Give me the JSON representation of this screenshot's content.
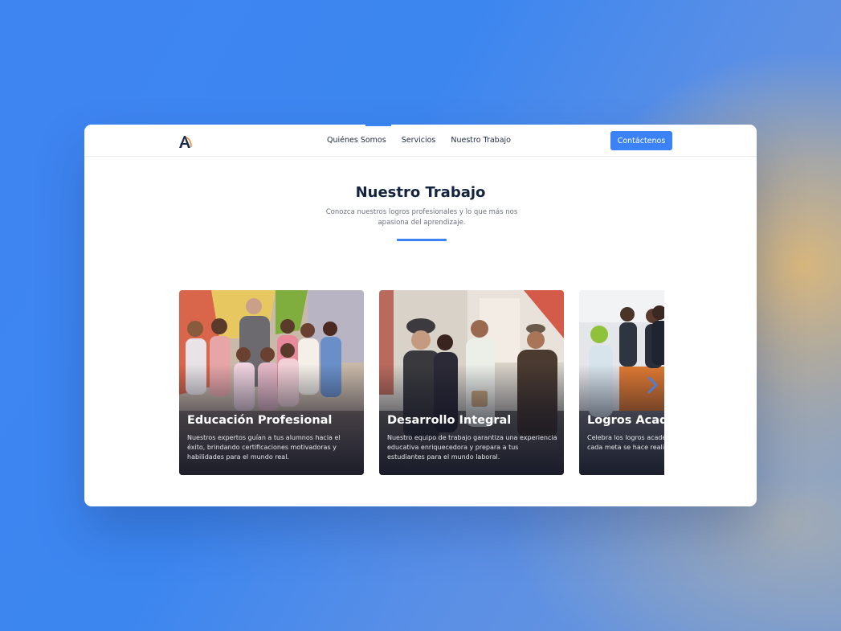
{
  "nav": {
    "links": [
      "Quiénes Somos",
      "Servicios",
      "Nuestro Trabajo"
    ],
    "cta": "Contáctenos"
  },
  "section": {
    "title": "Nuestro Trabajo",
    "subtitle": "Conozca nuestros logros profesionales y lo que más nos apasiona del aprendizaje."
  },
  "cards": [
    {
      "title": "Educación Profesional",
      "text": "Nuestros expertos guían a tus alumnos hacia el éxito, brindando certificaciones motivadoras y habilidades para el mundo real."
    },
    {
      "title": "Desarrollo Integral",
      "text": "Nuestro equipo de trabajo garantiza una experiencia educativa enriquecedora y prepara a tus estudiantes para el mundo laboral."
    },
    {
      "title": "Logros Académicos",
      "text": "Celebra los logros académicos y sé testigo de cómo cada meta se hace realidad."
    }
  ],
  "colors": {
    "accent": "#3b82f6",
    "heading": "#142340"
  },
  "icons": {
    "logo": "brand-logo-icon",
    "next": "chevron-right-icon"
  }
}
